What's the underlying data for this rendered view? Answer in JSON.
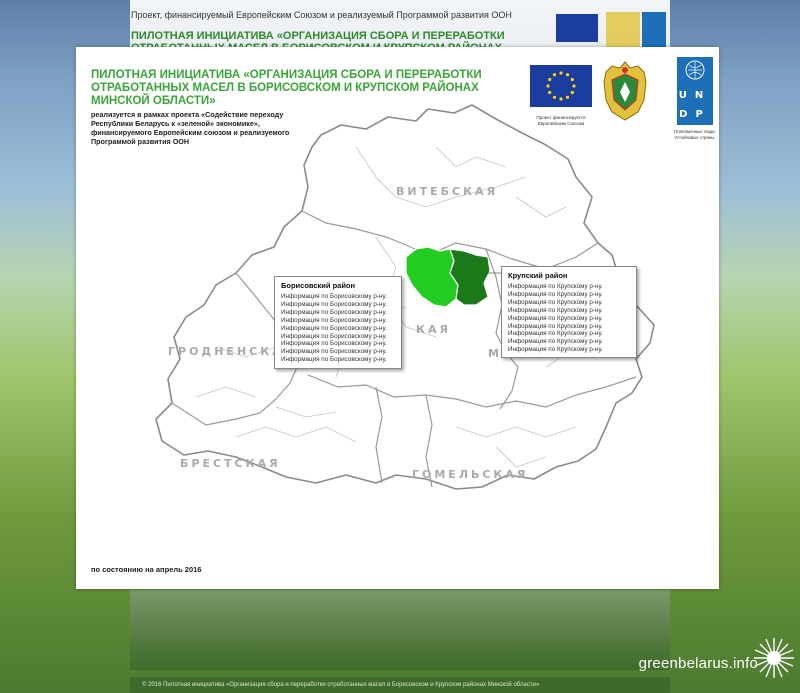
{
  "background": {
    "header_text": "Проект, финансируемый Европейским Союзом и реализуемый Программой развития ООН",
    "title": "ПИЛОТНАЯ ИНИЦИАТИВА «ОРГАНИЗАЦИЯ СБОРА И ПЕРЕРАБОТКИ ОТРАБОТАННЫХ МАСЕЛ В БОРИСОВСКОМ И КРУПСКОМ РАЙОНАХ",
    "footer": "© 2016 Пилотная инициатива «Организация сбора и переработки отработанных масел в Борисовском и Крупском районах Минской области»"
  },
  "brand": "greenbelarus.info",
  "panel": {
    "title": "ПИЛОТНАЯ ИНИЦИАТИВА «ОРГАНИЗАЦИЯ СБОРА И ПЕРЕРАБОТКИ ОТРАБОТАННЫХ МАСЕЛ В БОРИСОВСКОМ И КРУПСКОМ  РАЙОНАХ МИНСКОЙ ОБЛАСТИ»",
    "subtitle": "реализуется в рамках проекта «Содействие переходу Республики Беларусь к «зеленой» экономике», финансируемого Европейским союзом и реализуемого Программой развития ООН",
    "date": "по состоянию на апрель 2016"
  },
  "logos": {
    "eu_caption": "Проект финансируется Европейским Союзом",
    "undp_letters": "U N D P",
    "undp_caption": "Полномочные люди. Устойчивые страны."
  },
  "map": {
    "regions": {
      "vitebsk": "ВИТЕБСКАЯ",
      "grodno": "ГРОДНЕНСКАЯ",
      "minsk": "КАЯ",
      "mogilev": "МОГИЛЕВСКАЯ",
      "brest": "БРЕСТСКАЯ",
      "gomel": "ГОМЕЛЬСКАЯ"
    },
    "colors": {
      "borisov": "#22cc22",
      "krupki": "#1a7a1a",
      "border": "#8a8a8a"
    }
  },
  "callouts": {
    "borisov": {
      "title": "Борисовский район",
      "lines": [
        "Информация по Борисовскому р-ну.",
        "Информация по Борисовскому р-ну.",
        "Информация по Борисовскому р-ну.",
        "Информация по Борисовскому р-ну.",
        "Информация по Борисовскому р-ну.",
        "Информация по Борисовскому р-ну.",
        "Информация по Борисовскому р-ну.",
        "Информация по Борисовскому р-ну.",
        "Информация по Борисовскому р-ну."
      ]
    },
    "krupki": {
      "title": "Крупский район",
      "lines": [
        "Информация по Крупскому р-ну.",
        "Информация по Крупскому р-ну.",
        "Информация по Крупскому р-ну.",
        "Информация по Крупскому р-ну.",
        "Информация по Крупскому р-ну.",
        "Информация по Крупскому р-ну.",
        "Информация по Крупскому р-ну.",
        "Информация по Крупскому р-ну.",
        "Информация по Крупскому р-ну."
      ]
    }
  }
}
